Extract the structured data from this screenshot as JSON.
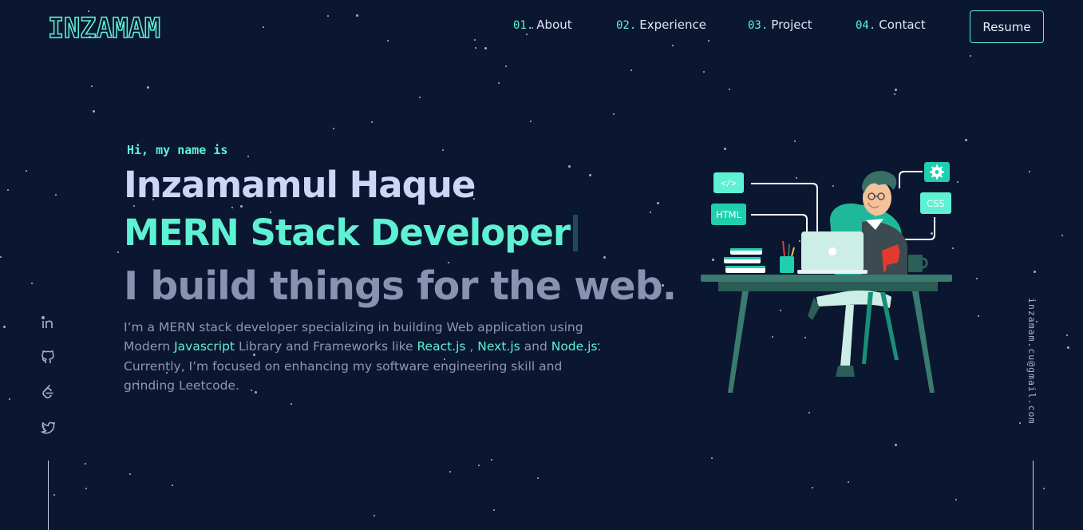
{
  "header": {
    "logo_text": "INZAMAM",
    "nav": [
      {
        "num": "01.",
        "label": "About"
      },
      {
        "num": "02.",
        "label": "Experience"
      },
      {
        "num": "03.",
        "label": "Project"
      },
      {
        "num": "04.",
        "label": "Contact"
      }
    ],
    "resume_label": "Resume"
  },
  "hero": {
    "greeting": "Hi, my name is",
    "name": "Inzamamul Haque",
    "role": "MERN Stack Developer",
    "tagline": "I build things for the web.",
    "description": {
      "p1": "I’m a MERN stack developer specializing in building Web application using Modern ",
      "h1": "Javascript",
      "p2": " Library and Frameworks like ",
      "h2": "React.js",
      "p3": " , ",
      "h3": "Next.js",
      "p4": " and ",
      "h4": "Node.js",
      "p5": ". Currently, I’m focused on enhancing my software engineering skill and grinding Leetcode."
    }
  },
  "illustration": {
    "code_tag": "</>",
    "html_tag": "HTML",
    "css_tag": "CSS"
  },
  "social": {
    "icons": [
      "linkedin-icon",
      "github-icon",
      "leetcode-icon",
      "twitter-icon"
    ]
  },
  "email": "inzamam.cu@gmail.com",
  "colors": {
    "background": "#0b1730",
    "accent": "#5ef1d3",
    "heading": "#ccd6f6",
    "muted": "#8a92b2"
  }
}
